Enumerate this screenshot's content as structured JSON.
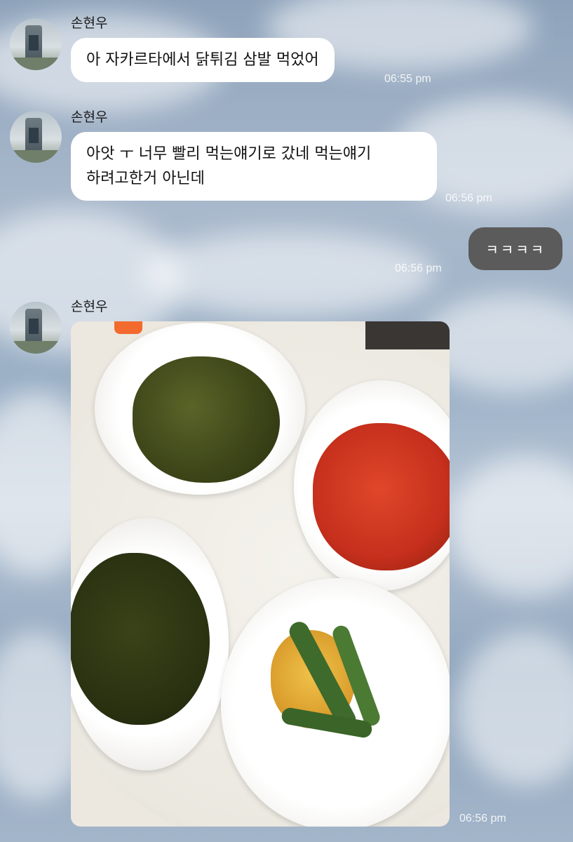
{
  "messages": [
    {
      "sender": "손현우",
      "text": "아 자카르타에서 닭튀김 삼발 먹었어",
      "time": "06:55 pm"
    },
    {
      "sender": "손현우",
      "text_line1": "아앗 ㅜ 너무 빨리 먹는얘기로 갔네 먹는얘기",
      "text_line2": "하려고한거 아닌데",
      "time": "06:56 pm"
    },
    {
      "sender": "me",
      "text": "ㅋㅋㅋㅋ",
      "time": "06:56 pm"
    },
    {
      "sender": "손현우",
      "type": "photo",
      "time": "06:56 pm"
    }
  ],
  "colors": {
    "my_bubble": "#5b5b5b",
    "their_bubble": "#ffffff"
  }
}
